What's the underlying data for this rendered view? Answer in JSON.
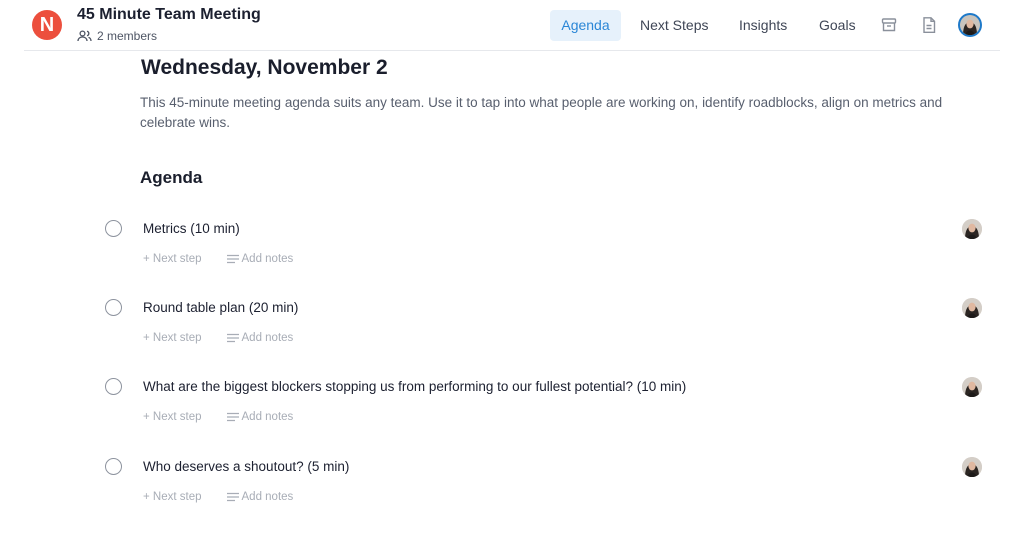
{
  "header": {
    "logo_letter": "N",
    "title": "45 Minute Team Meeting",
    "members": "2 members",
    "tabs": [
      {
        "label": "Agenda",
        "active": true
      },
      {
        "label": "Next Steps",
        "active": false
      },
      {
        "label": "Insights",
        "active": false
      },
      {
        "label": "Goals",
        "active": false
      }
    ],
    "icons": [
      "archive-icon",
      "document-icon",
      "user-avatar"
    ]
  },
  "main": {
    "date": "Wednesday, November 2",
    "description": "This 45-minute meeting agenda suits any team. Use it to tap into what people are working on, identify roadblocks, align on metrics and celebrate wins.",
    "section_heading": "Agenda",
    "items": [
      {
        "title": "Metrics (10 min)",
        "next_step": "+ Next step",
        "add_notes": "Add notes"
      },
      {
        "title": "Round table plan (20 min)",
        "next_step": "+ Next step",
        "add_notes": "Add notes"
      },
      {
        "title": "What are the biggest blockers stopping us from performing to our fullest potential? (10 min)",
        "next_step": "+ Next step",
        "add_notes": "Add notes"
      },
      {
        "title": "Who deserves a shoutout? (5 min)",
        "next_step": "+ Next step",
        "add_notes": "Add notes"
      }
    ]
  },
  "colors": {
    "brand": "#ec4f3d",
    "accent": "#2a86d6",
    "active_tab_bg": "#e6f1fb",
    "muted_text": "#a8adb6"
  }
}
